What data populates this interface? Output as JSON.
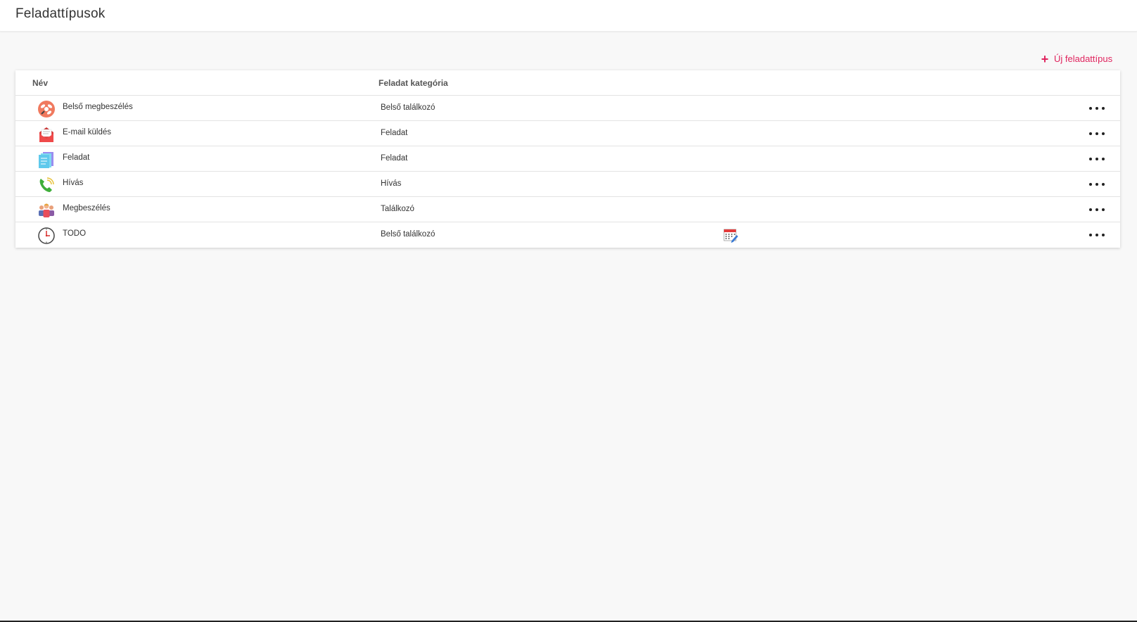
{
  "header": {
    "title": "Feladattípusok"
  },
  "actions": {
    "new_label": "Új feladattípus",
    "new_icon": "plus-icon"
  },
  "table": {
    "columns": [
      "Név",
      "Feladat kategória"
    ],
    "rows": [
      {
        "name": "Belső megbeszélés",
        "category": "Belső találkozó",
        "icon": "internal-meeting-icon",
        "calendar": false
      },
      {
        "name": "E-mail küldés",
        "category": "Feladat",
        "icon": "email-envelope-icon",
        "calendar": false
      },
      {
        "name": "Feladat",
        "category": "Feladat",
        "icon": "task-notes-icon",
        "calendar": false
      },
      {
        "name": "Hívás",
        "category": "Hívás",
        "icon": "phone-call-icon",
        "calendar": false
      },
      {
        "name": "Megbeszélés",
        "category": "Találkozó",
        "icon": "meeting-people-icon",
        "calendar": false
      },
      {
        "name": "TODO",
        "category": "Belső találkozó",
        "icon": "clock-icon",
        "calendar": true
      }
    ]
  },
  "colors": {
    "accent": "#e0245e",
    "background": "#f8f8f8",
    "card": "#ffffff"
  }
}
